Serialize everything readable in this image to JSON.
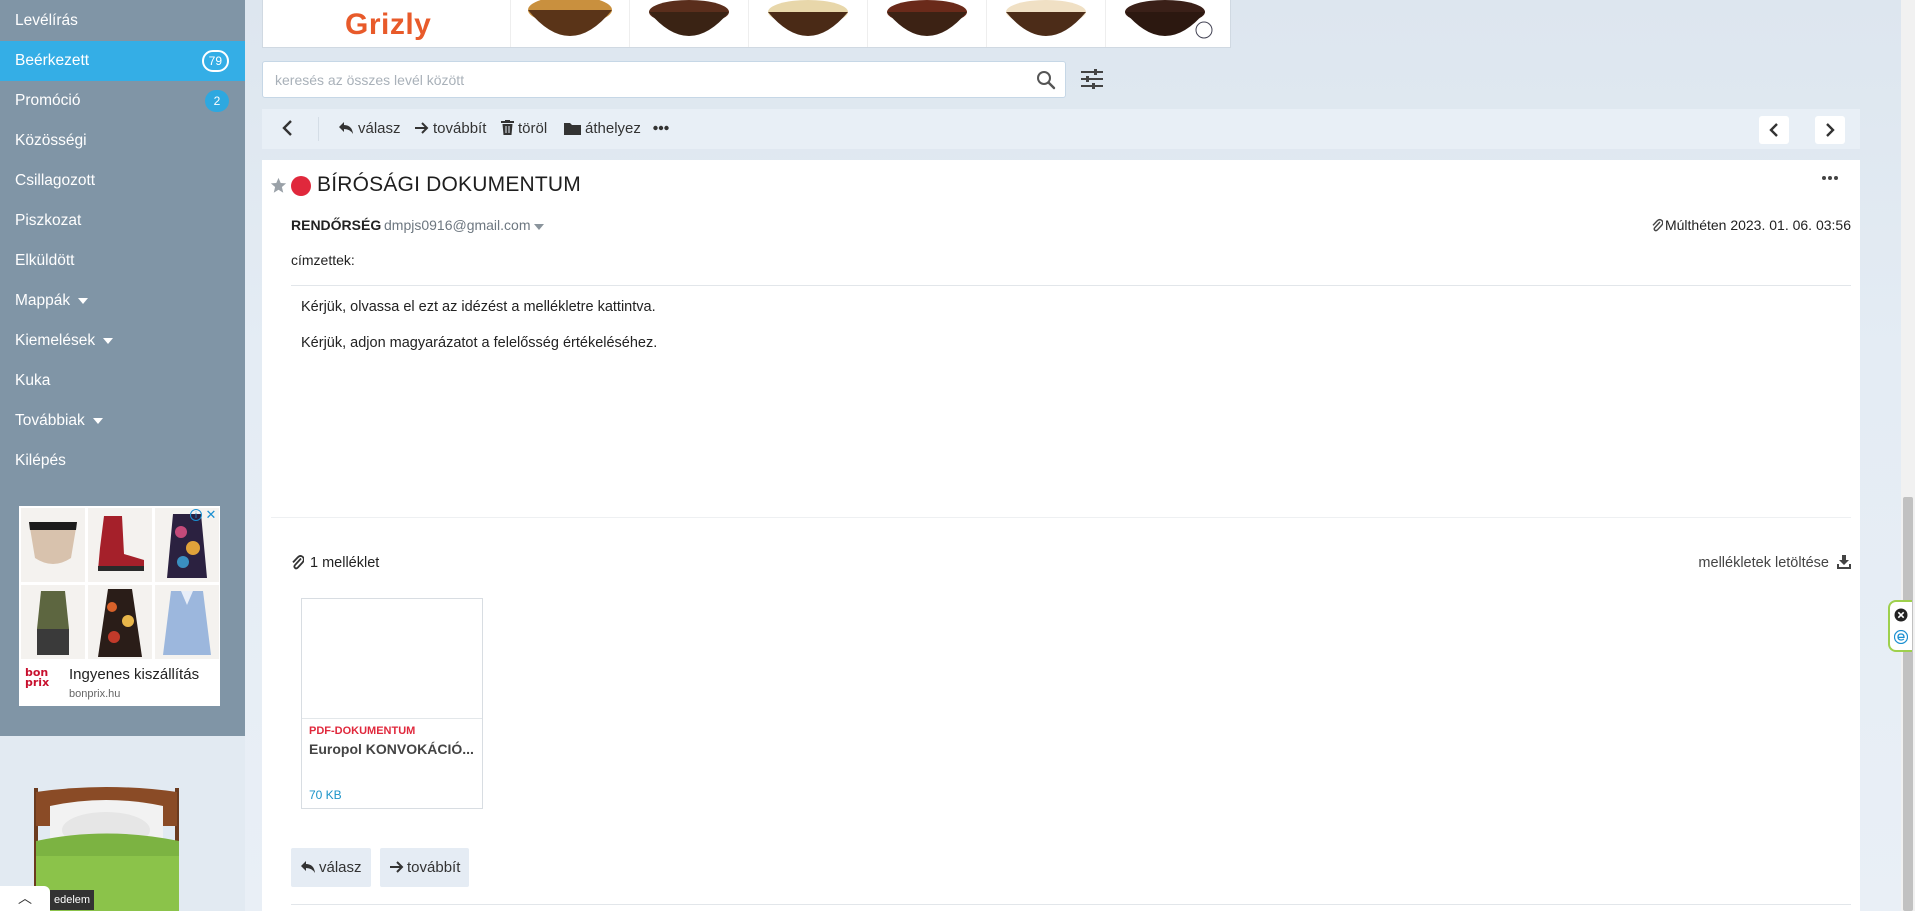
{
  "sidebar": {
    "items": [
      {
        "label": "Levélírás"
      },
      {
        "label": "Beérkezett",
        "badge": "79"
      },
      {
        "label": "Promóció",
        "badge": "2"
      },
      {
        "label": "Közösségi"
      },
      {
        "label": "Csillagozott"
      },
      {
        "label": "Piszkozat"
      },
      {
        "label": "Elküldött"
      },
      {
        "label": "Mappák"
      },
      {
        "label": "Kiemelések"
      },
      {
        "label": "Kuka"
      },
      {
        "label": "Továbbiak"
      },
      {
        "label": "Kilépés"
      }
    ],
    "ad": {
      "headline": "Ingyenes kiszállítás",
      "domain": "bonprix.hu",
      "logo_text": "bon prix"
    },
    "bottom_label": "edelem"
  },
  "banner": {
    "brand": "Grizly"
  },
  "search": {
    "placeholder": "keresés az összes levél között"
  },
  "toolbar": {
    "reply": "válasz",
    "forward": "továbbít",
    "delete": "töröl",
    "move": "áthelyez"
  },
  "message": {
    "subject": "BÍRÓSÁGI DOKUMENTUM",
    "sender_name": "RENDŐRSÉG",
    "sender_email": "dmpjs0916@gmail.com",
    "date": "Múlthéten 2023. 01. 06. 03:56",
    "recipients_label": "címzettek:",
    "body": [
      "Kérjük, olvassa el ezt az idézést a mellékletre kattintva.",
      "Kérjük, adjon magyarázatot a felelősség értékeléséhez."
    ]
  },
  "attachments": {
    "count_label": "1 melléklet",
    "download_all": "mellékletek letöltése",
    "items": [
      {
        "type": "PDF-DOKUMENTUM",
        "name": "Europol KONVOKÁCIÓ...",
        "size": "70 KB"
      }
    ]
  },
  "actions": {
    "reply": "válasz",
    "forward": "továbbít"
  },
  "colors": {
    "sidebar_bg": "#8095a6",
    "active_blue": "#34aee6",
    "flag_red": "#e0283c",
    "brand_orange": "#e85a2a"
  }
}
